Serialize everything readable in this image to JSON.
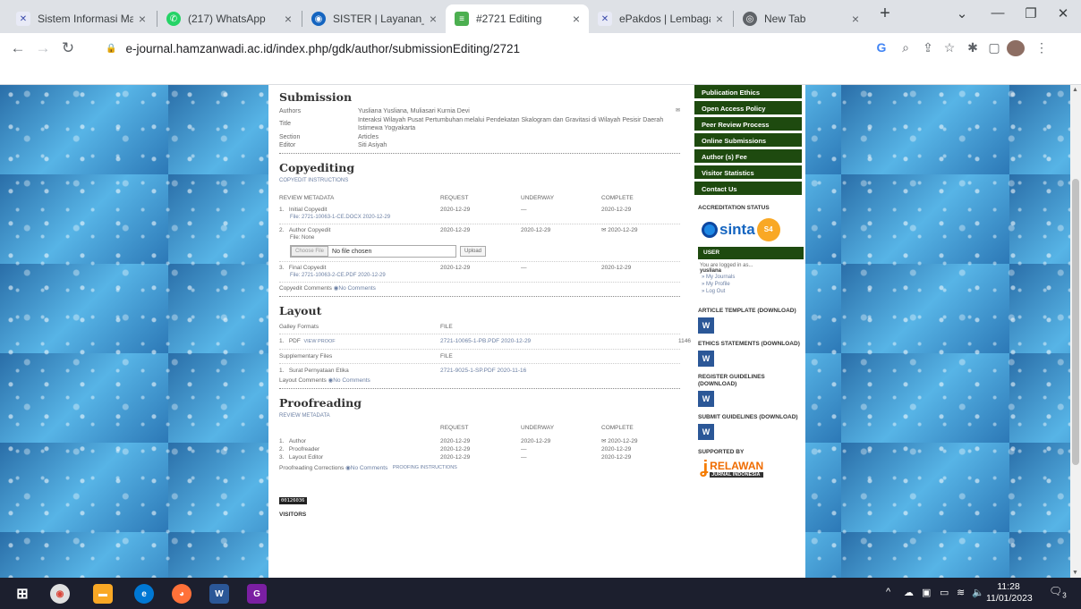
{
  "browser": {
    "tabs": [
      {
        "title": "Sistem Informasi Man",
        "icon": "Sx"
      },
      {
        "title": "(217) WhatsApp",
        "icon": "wa"
      },
      {
        "title": "SISTER | Layanan_bkd",
        "icon": "si"
      },
      {
        "title": "#2721 Editing",
        "icon": "oj"
      },
      {
        "title": "ePakdos | Lembaga La",
        "icon": "Sx"
      },
      {
        "title": "New Tab",
        "icon": "nt"
      }
    ],
    "url": "e-journal.hamzanwadi.ac.id/index.php/gdk/author/submissionEditing/2721"
  },
  "submission": {
    "heading": "Submission",
    "authors_label": "Authors",
    "authors": "Yusliana Yusliana, Muliasari Kurnia Devi",
    "title_label": "Title",
    "title": "Interaksi Wilayah Pusat Pertumbuhan melalui Pendekatan Skalogram dan Gravitasi di Wilayah Pesisir Daerah Istimewa Yogyakarta",
    "section_label": "Section",
    "section": "Articles",
    "editor_label": "Editor",
    "editor": "Siti Asiyah"
  },
  "copyediting": {
    "heading": "Copyediting",
    "instructions": "COPYEDIT INSTRUCTIONS",
    "review_metadata": "REVIEW METADATA",
    "col_request": "REQUEST",
    "col_underway": "UNDERWAY",
    "col_complete": "COMPLETE",
    "rows": [
      {
        "num": "1.",
        "name": "Initial Copyedit",
        "request": "2020-12-29",
        "underway": "—",
        "complete": "2020-12-29",
        "file": "File: 2721-10063-1-CE.DOCX 2020-12-29"
      },
      {
        "num": "2.",
        "name": "Author Copyedit",
        "request": "2020-12-29",
        "underway": "2020-12-29",
        "complete": "2020-12-29",
        "file": "File: None"
      },
      {
        "num": "3.",
        "name": "Final Copyedit",
        "request": "2020-12-29",
        "underway": "—",
        "complete": "2020-12-29",
        "file": "File: 2721-10063-2-CE.PDF 2020-12-29"
      }
    ],
    "choose_file": "Choose File",
    "no_file": "No file chosen",
    "upload": "Upload",
    "comments": "Copyedit Comments",
    "no_comments": "No Comments"
  },
  "layout": {
    "heading": "Layout",
    "galley_formats": "Galley Formats",
    "file_col": "FILE",
    "galley_num": "1.",
    "galley_name": "PDF",
    "view_proof": "VIEW PROOF",
    "galley_file": "2721-10065-1-PB.PDF 2020-12-29",
    "galley_count": "1146",
    "supp_files": "Supplementary Files",
    "supp_num": "1.",
    "supp_name": "Surat Pernyataan Etika",
    "supp_file": "2721-9025-1-SP.PDF 2020-11-16",
    "comments": "Layout Comments",
    "no_comments": "No Comments"
  },
  "proofreading": {
    "heading": "Proofreading",
    "review_metadata": "REVIEW METADATA",
    "col_request": "REQUEST",
    "col_underway": "UNDERWAY",
    "col_complete": "COMPLETE",
    "rows": [
      {
        "num": "1.",
        "name": "Author",
        "request": "2020-12-29",
        "underway": "2020-12-29",
        "complete": "2020-12-29"
      },
      {
        "num": "2.",
        "name": "Proofreader",
        "request": "2020-12-29",
        "underway": "—",
        "complete": "2020-12-29"
      },
      {
        "num": "3.",
        "name": "Layout Editor",
        "request": "2020-12-29",
        "underway": "—",
        "complete": "2020-12-29"
      }
    ],
    "corrections": "Proofreading Corrections",
    "no_comments": "No Comments",
    "instructions": "PROOFING INSTRUCTIONS"
  },
  "footer": {
    "counter": "00126036",
    "visitors": "VISITORS"
  },
  "sidebar": {
    "menu": [
      "Publication Ethics",
      "Open Access Policy",
      "Peer Review Process",
      "Online Submissions",
      "Author (s) Fee",
      "Visitor Statistics",
      "Contact Us"
    ],
    "accreditation": "ACCREDITATION STATUS",
    "sinta": "sinta",
    "sinta_level": "S4",
    "user_heading": "USER",
    "logged_in_as": "You are logged in as...",
    "username": "yusliana",
    "user_links": [
      "» My Journals",
      "» My Profile",
      "» Log Out"
    ],
    "article_template": "ARTICLE TEMPLATE (DOWNLOAD)",
    "ethics": "ETHICS STATEMENTS (DOWNLOAD)",
    "register": "REGISTER GUIDELINES (DOWNLOAD)",
    "submit": "SUBMIT GUIDELINES (DOWNLOAD)",
    "supported_by": "SUPPORTED BY",
    "relawan": "RELAWAN",
    "jurnal_indonesia": "JURNAL INDONESIA"
  },
  "taskbar": {
    "time": "11:28",
    "date": "11/01/2023",
    "notifications": "3"
  },
  "colors": {
    "sidebar_green": "#1e4a0f",
    "taskbar": "#1c1f2e",
    "word_blue": "#2b5797"
  }
}
